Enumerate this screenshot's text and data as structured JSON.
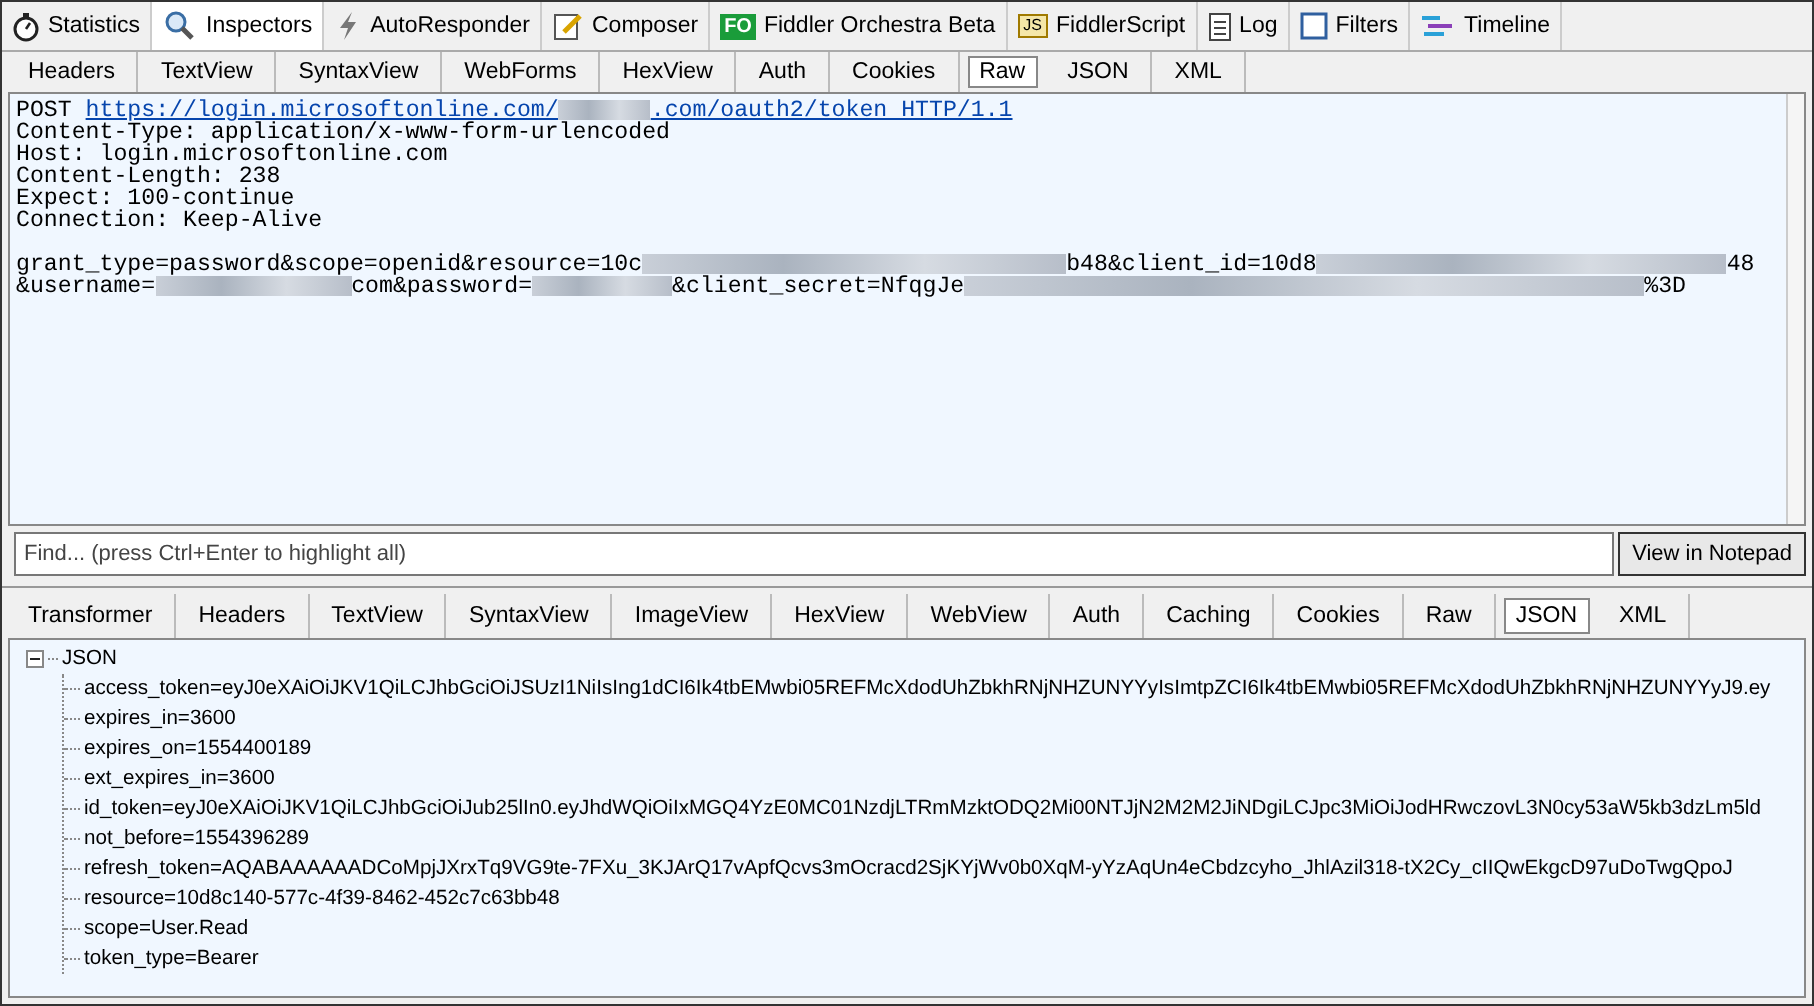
{
  "top_tabs": [
    {
      "label": "Statistics",
      "selected": false
    },
    {
      "label": "Inspectors",
      "selected": true
    },
    {
      "label": "AutoResponder",
      "selected": false
    },
    {
      "label": "Composer",
      "selected": false
    },
    {
      "label": "Fiddler Orchestra Beta",
      "badge": "FO",
      "selected": false
    },
    {
      "label": "FiddlerScript",
      "badge": "JS",
      "selected": false
    },
    {
      "label": "Log",
      "selected": false
    },
    {
      "label": "Filters",
      "selected": false
    },
    {
      "label": "Timeline",
      "selected": false
    }
  ],
  "request_tabs": [
    {
      "label": "Headers",
      "selected": false
    },
    {
      "label": "TextView",
      "selected": false
    },
    {
      "label": "SyntaxView",
      "selected": false
    },
    {
      "label": "WebForms",
      "selected": false
    },
    {
      "label": "HexView",
      "selected": false
    },
    {
      "label": "Auth",
      "selected": false
    },
    {
      "label": "Cookies",
      "selected": false
    },
    {
      "label": "Raw",
      "selected": true
    },
    {
      "label": "JSON",
      "selected": false
    },
    {
      "label": "XML",
      "selected": false
    }
  ],
  "request_raw": [
    [
      {
        "kind": "text",
        "text": "POST "
      },
      {
        "kind": "link",
        "text": "https://login.microsoftonline.com/"
      },
      {
        "kind": "redacted"
      },
      {
        "kind": "link",
        "text": ".com/oauth2/token HTTP/1.1"
      }
    ],
    [
      {
        "kind": "text",
        "text": "Content-Type: application/x-www-form-urlencoded"
      }
    ],
    [
      {
        "kind": "text",
        "text": "Host: login.microsoftonline.com"
      }
    ],
    [
      {
        "kind": "text",
        "text": "Content-Length: 238"
      }
    ],
    [
      {
        "kind": "text",
        "text": "Expect: 100-continue"
      }
    ],
    [
      {
        "kind": "text",
        "text": "Connection: Keep-Alive"
      }
    ],
    [
      {
        "kind": "text",
        "text": "grant_type=password&scope=openid&resource=10c"
      },
      {
        "kind": "redacted"
      },
      {
        "kind": "text",
        "text": "b48&client_id=10d8"
      },
      {
        "kind": "redacted"
      },
      {
        "kind": "text",
        "text": "48"
      }
    ],
    [
      {
        "kind": "text",
        "text": "&username="
      },
      {
        "kind": "redacted"
      },
      {
        "kind": "text",
        "text": "com&password="
      },
      {
        "kind": "redacted"
      },
      {
        "kind": "text",
        "text": "&client_secret=NfqgJe"
      },
      {
        "kind": "redacted"
      },
      {
        "kind": "text",
        "text": "%3D"
      }
    ]
  ],
  "find": {
    "placeholder": "Find... (press Ctrl+Enter to highlight all)"
  },
  "notepad_button": "View in Notepad",
  "response_tabs": [
    {
      "label": "Transformer",
      "selected": false
    },
    {
      "label": "Headers",
      "selected": false
    },
    {
      "label": "TextView",
      "selected": false
    },
    {
      "label": "SyntaxView",
      "selected": false
    },
    {
      "label": "ImageView",
      "selected": false
    },
    {
      "label": "HexView",
      "selected": false
    },
    {
      "label": "WebView",
      "selected": false
    },
    {
      "label": "Auth",
      "selected": false
    },
    {
      "label": "Caching",
      "selected": false
    },
    {
      "label": "Cookies",
      "selected": false
    },
    {
      "label": "Raw",
      "selected": false
    },
    {
      "label": "JSON",
      "selected": true
    },
    {
      "label": "XML",
      "selected": false
    }
  ],
  "json_tree": {
    "label": "JSON",
    "expanded": true,
    "children": [
      {
        "label": "access_token=eyJ0eXAiOiJKV1QiLCJhbGciOiJSUzI1NiIsIng1dCI6Ik4tbEMwbi05REFMcXdodUhZbkhRNjNHZUNYYyIsImtpZCI6Ik4tbEMwbi05REFMcXdodUhZbkhRNjNHZUNYYyJ9.ey"
      },
      {
        "label": "expires_in=3600"
      },
      {
        "label": "expires_on=1554400189"
      },
      {
        "label": "ext_expires_in=3600"
      },
      {
        "label": "id_token=eyJ0eXAiOiJKV1QiLCJhbGciOiJub25lIn0.eyJhdWQiOiIxMGQ4YzE0MC01NzdjLTRmMzktODQ2Mi00NTJjN2M2M2JiNDgiLCJpc3MiOiJodHRwczovL3N0cy53aW5kb3dzLm5ld"
      },
      {
        "label": "not_before=1554396289"
      },
      {
        "label": "refresh_token=AQABAAAAAADCoMpjJXrxTq9VG9te-7FXu_3KJArQ17vApfQcvs3mOcracd2SjKYjWv0b0XqM-yYzAqUn4eCbdzcyho_JhlAzil318-tX2Cy_cIIQwEkgcD97uDoTwgQpoJ"
      },
      {
        "label": "resource=10d8c140-577c-4f39-8462-452c7c63bb48"
      },
      {
        "label": "scope=User.Read"
      },
      {
        "label": "token_type=Bearer"
      }
    ]
  }
}
